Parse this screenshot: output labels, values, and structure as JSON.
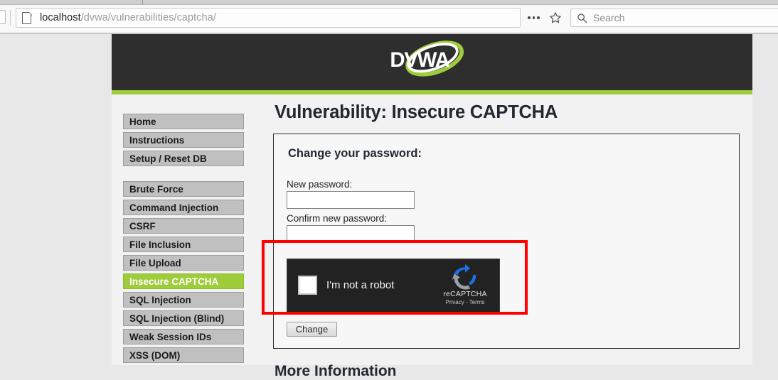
{
  "browser": {
    "url_host": "localhost",
    "url_path": "/dvwa/vulnerabilities/captcha/",
    "page_icon_name": "document-icon",
    "page_actions_label": "...",
    "bookmark_icon_name": "star-icon",
    "search_placeholder": "Search",
    "search_icon_name": "magnifier-icon"
  },
  "site": {
    "logo_text": "DVWA",
    "accent_green": "#9fcc3b",
    "header_dark": "#2e2e2e"
  },
  "sidebar": {
    "group_one": [
      {
        "label": "Home",
        "active": false
      },
      {
        "label": "Instructions",
        "active": false
      },
      {
        "label": "Setup / Reset DB",
        "active": false
      }
    ],
    "group_two": [
      {
        "label": "Brute Force",
        "active": false
      },
      {
        "label": "Command Injection",
        "active": false
      },
      {
        "label": "CSRF",
        "active": false
      },
      {
        "label": "File Inclusion",
        "active": false
      },
      {
        "label": "File Upload",
        "active": false
      },
      {
        "label": "Insecure CAPTCHA",
        "active": true
      },
      {
        "label": "SQL Injection",
        "active": false
      },
      {
        "label": "SQL Injection (Blind)",
        "active": false
      },
      {
        "label": "Weak Session IDs",
        "active": false
      },
      {
        "label": "XSS (DOM)",
        "active": false
      }
    ]
  },
  "main": {
    "page_title": "Vulnerability: Insecure CAPTCHA",
    "form_heading": "Change your password:",
    "new_password_label": "New password:",
    "new_password_value": "",
    "confirm_password_label": "Confirm new password:",
    "confirm_password_value": "",
    "submit_label": "Change",
    "more_info_heading": "More Information"
  },
  "recaptcha": {
    "checkbox_label": "I'm not a robot",
    "brand_name": "reCAPTCHA",
    "legal_text": "Privacy - Terms",
    "logo_icon_name": "recaptcha-logo-icon",
    "checked": false
  },
  "annotation": {
    "color": "#ff0000"
  }
}
